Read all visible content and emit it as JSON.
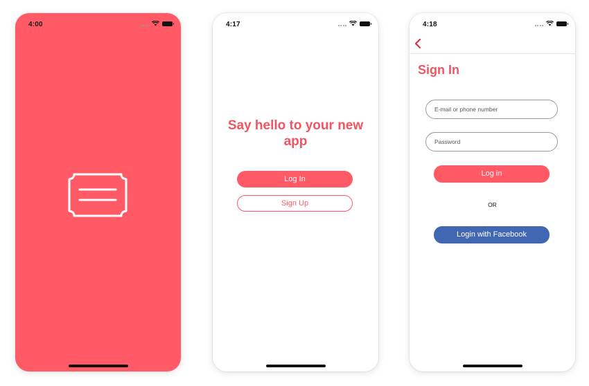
{
  "colors": {
    "brand": "#ff5a66",
    "brand_text": "#f25562",
    "facebook": "#4267b2"
  },
  "screens": {
    "splash": {
      "time": "4:00",
      "logo_icon": "ticket-menu-icon"
    },
    "welcome": {
      "time": "4:17",
      "title": "Say hello to your new app",
      "login_label": "Log In",
      "signup_label": "Sign Up"
    },
    "signin": {
      "time": "4:18",
      "back_icon": "chevron-left-icon",
      "title": "Sign In",
      "email_placeholder": "E-mail or phone number",
      "password_placeholder": "Password",
      "login_label": "Log in",
      "or_label": "OR",
      "facebook_label": "Login with Facebook"
    }
  },
  "status_icons": [
    "signal-dots-icon",
    "wifi-icon",
    "battery-icon"
  ]
}
